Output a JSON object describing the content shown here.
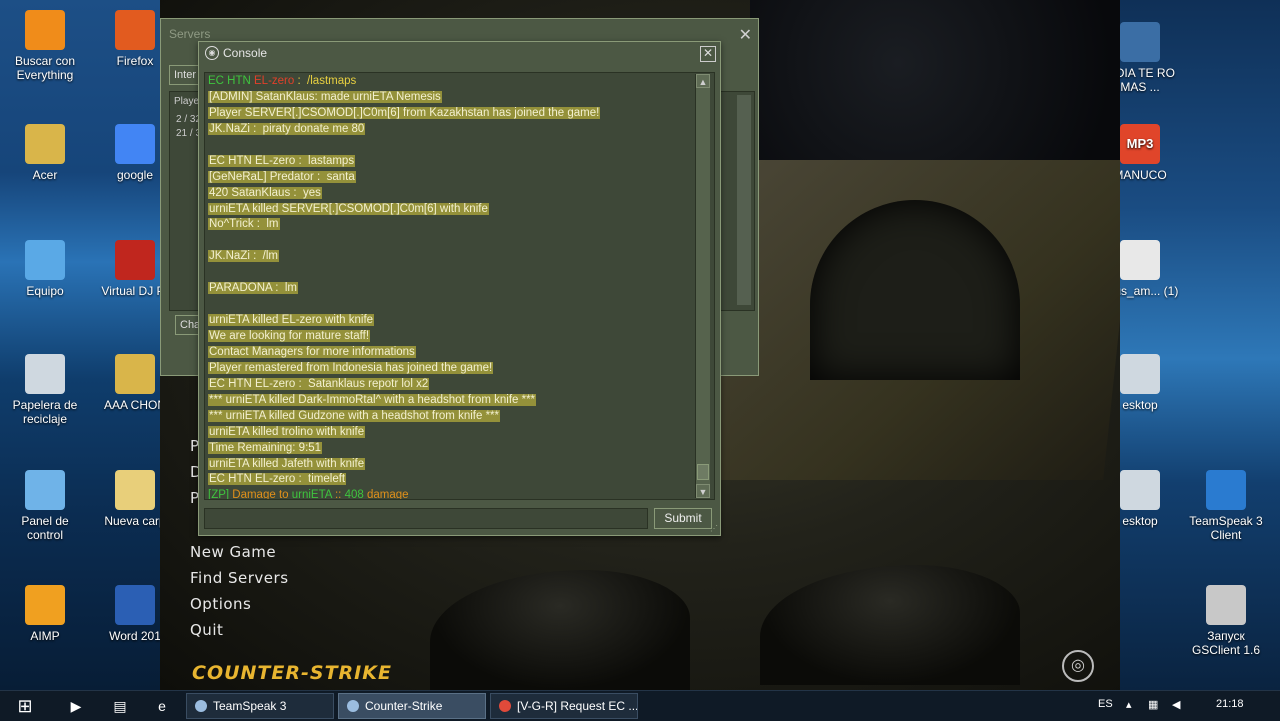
{
  "desktop_left": [
    {
      "label": "Buscar con Everything",
      "icon": "search-icon",
      "color": "#f08c1a"
    },
    {
      "label": "Firefox",
      "icon": "firefox-icon",
      "color": "#e25b1f"
    },
    {
      "label": "Acer",
      "icon": "user-folder-icon",
      "color": "#d9b54a"
    },
    {
      "label": "google",
      "icon": "chrome-icon",
      "color": "#4285f4"
    },
    {
      "label": "Equipo",
      "icon": "computer-icon",
      "color": "#5aa9e6"
    },
    {
      "label": "Virtual DJ Pr",
      "icon": "virtual-dj-icon",
      "color": "#c0261e"
    },
    {
      "label": "Papelera de reciclaje",
      "icon": "recycle-bin-icon",
      "color": "#cfd8e0"
    },
    {
      "label": "AAA CHON",
      "icon": "folder-icon",
      "color": "#d9b54a"
    },
    {
      "label": "Panel de control",
      "icon": "control-panel-icon",
      "color": "#6fb3e8"
    },
    {
      "label": "Nueva carp",
      "icon": "folder-icon",
      "color": "#e8cf7a"
    },
    {
      "label": "AIMP",
      "icon": "aimp-icon",
      "color": "#f0a020"
    },
    {
      "label": "Word 201",
      "icon": "word-icon",
      "color": "#2b5fb4"
    }
  ],
  "desktop_right": [
    {
      "label": "A DIA TE RO MAS ...",
      "icon": "video-file-icon",
      "color": "#3b6ea5"
    },
    {
      "label": "MANUCO",
      "icon": "mp3-icon",
      "color": "#e0452a",
      "text": "MP3"
    },
    {
      "label": "virus_am... (1)",
      "icon": "script-file-icon",
      "color": "#e8e8e8"
    },
    {
      "label": "esktop",
      "icon": "file-icon",
      "color": "#cfd8e0"
    },
    {
      "label": "esktop",
      "icon": "file-icon",
      "color": "#cfd8e0"
    },
    {
      "label": "TeamSpeak 3 Client",
      "icon": "teamspeak-icon",
      "color": "#2a7bd0"
    },
    {
      "label": "Запуск GSClient 1.6",
      "icon": "counter-strike-icon",
      "color": "#c8c8c8"
    }
  ],
  "main_menu": {
    "partial_letters": [
      "P",
      "D",
      "P"
    ],
    "items": [
      "New Game",
      "Find Servers",
      "Options",
      "Quit"
    ],
    "logo": "COUNTER-STRIKE"
  },
  "servers_window": {
    "title": "Servers",
    "tab": "Inter",
    "header": "Playe",
    "rows": [
      "2 / 32",
      "21 / 3"
    ],
    "chat_button": "Cha",
    "right_button": "t"
  },
  "console": {
    "title": "Console",
    "lines": [
      [
        {
          "t": "EC HTN ",
          "c": "g"
        },
        {
          "t": "EL-zero",
          "c": "r"
        },
        {
          "t": " :  /lastmaps",
          "c": "y"
        }
      ],
      [
        {
          "t": "[ADMIN] SatanKlaus: made urniETA Nemesis",
          "c": "hl"
        }
      ],
      [
        {
          "t": "Player SERVER[.]CSOMOD[.]C0m[6] from Kazakhstan has joined the game!",
          "c": "hl"
        }
      ],
      [
        {
          "t": "JK.NaZi :  piraty donate me 80",
          "c": "hl"
        }
      ],
      [],
      [
        {
          "t": "EC HTN EL-zero :  lastamps",
          "c": "hl"
        }
      ],
      [
        {
          "t": "[GeNeRaL] Predator :  santa",
          "c": "hl"
        }
      ],
      [
        {
          "t": "420 SatanKlaus :  yes",
          "c": "hl"
        }
      ],
      [
        {
          "t": "urniETA killed SERVER[.]CSOMOD[.]C0m[6] with knife",
          "c": "hl"
        }
      ],
      [
        {
          "t": "No^Trick :  lm",
          "c": "hl"
        }
      ],
      [],
      [
        {
          "t": "JK.NaZi :  /lm",
          "c": "hl"
        }
      ],
      [],
      [
        {
          "t": "PARADONA :  lm",
          "c": "hl"
        }
      ],
      [],
      [
        {
          "t": "urniETA killed EL-zero with knife",
          "c": "hl"
        }
      ],
      [
        {
          "t": "We are looking for mature staff!",
          "c": "hl"
        }
      ],
      [
        {
          "t": "Contact Managers for more informations",
          "c": "hl"
        }
      ],
      [
        {
          "t": "Player remastered from Indonesia has joined the game!",
          "c": "hl"
        }
      ],
      [
        {
          "t": "EC HTN EL-zero :  Satanklaus repotr lol x2",
          "c": "hl"
        }
      ],
      [
        {
          "t": "*** urniETA killed Dark-ImmoRtal^ with a headshot from knife ***",
          "c": "hl"
        }
      ],
      [
        {
          "t": "*** urniETA killed Gudzone with a headshot from knife ***",
          "c": "hl"
        }
      ],
      [
        {
          "t": "urniETA killed trolino with knife",
          "c": "hl"
        }
      ],
      [
        {
          "t": "Time Remaining: 9:51",
          "c": "hl"
        }
      ],
      [
        {
          "t": "urniETA killed Jafeth with knife",
          "c": "hl"
        }
      ],
      [
        {
          "t": "EC HTN EL-zero :  timeleft",
          "c": "hl"
        }
      ],
      [
        {
          "t": "[ZP] ",
          "c": "g"
        },
        {
          "t": "Damage to ",
          "c": "o"
        },
        {
          "t": "urniETA",
          "c": "g"
        },
        {
          "t": " :: ",
          "c": "o"
        },
        {
          "t": "408",
          "c": "g"
        },
        {
          "t": " damage",
          "c": "o"
        }
      ]
    ],
    "input_value": "",
    "submit_label": "Submit"
  },
  "taskbar": {
    "buttons": [
      {
        "label": "TeamSpeak 3",
        "icon": "teamspeak-icon",
        "active": false
      },
      {
        "label": "Counter-Strike",
        "icon": "counter-strike-icon",
        "active": true
      },
      {
        "label": "[V-G-R] Request EC ...",
        "icon": "chrome-icon",
        "active": false
      }
    ],
    "language": "ES",
    "clock": "21:18"
  }
}
